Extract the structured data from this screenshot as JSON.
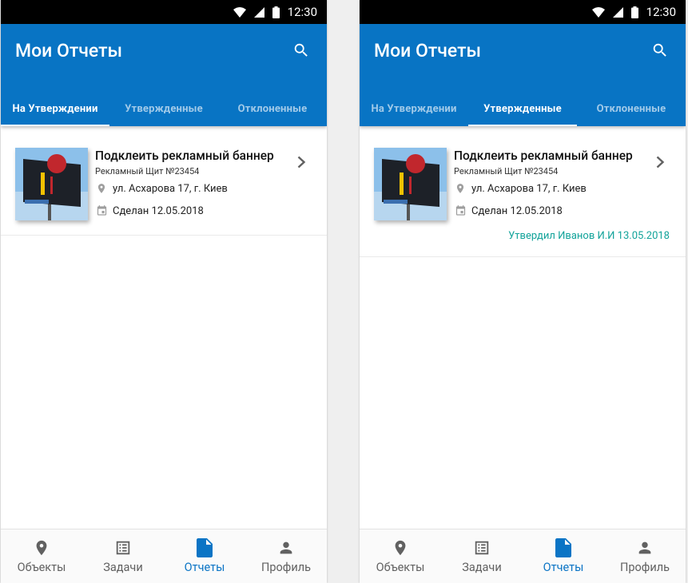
{
  "colors": {
    "primary": "#0874c4",
    "accent_active": "#0a74c5",
    "approved_text": "#12a39a",
    "status_bar": "#000000"
  },
  "screens": [
    {
      "status": {
        "time": "12:30"
      },
      "appbar": {
        "title": "Мои Отчеты"
      },
      "tabs": [
        {
          "label": "На Утверждении",
          "active": true
        },
        {
          "label": "Утвержденные",
          "active": false
        },
        {
          "label": "Отклоненные",
          "active": false
        }
      ],
      "report": {
        "title": "Подклеить рекламный баннер",
        "subtitle": "Рекламный Щит №23454",
        "address": "ул. Асхарова 17, г. Киев",
        "done": "Сделан 12.05.2018"
      },
      "nav": [
        {
          "label": "Объекты",
          "icon": "location-pin-icon"
        },
        {
          "label": "Задачи",
          "icon": "task-list-icon"
        },
        {
          "label": "Отчеты",
          "icon": "document-icon",
          "active": true
        },
        {
          "label": "Профиль",
          "icon": "person-icon"
        }
      ]
    },
    {
      "status": {
        "time": "12:30"
      },
      "appbar": {
        "title": "Мои Отчеты"
      },
      "tabs": [
        {
          "label": "На Утверждении",
          "active": false
        },
        {
          "label": "Утвержденные",
          "active": true
        },
        {
          "label": "Отклоненные",
          "active": false
        }
      ],
      "report": {
        "title": "Подклеить рекламный баннер",
        "subtitle": "Рекламный Щит №23454",
        "address": "ул. Асхарова 17, г. Киев",
        "done": "Сделан 12.05.2018",
        "approved": "Утвердил Иванов И.И 13.05.2018"
      },
      "nav": [
        {
          "label": "Объекты",
          "icon": "location-pin-icon"
        },
        {
          "label": "Задачи",
          "icon": "task-list-icon"
        },
        {
          "label": "Отчеты",
          "icon": "document-icon",
          "active": true
        },
        {
          "label": "Профиль",
          "icon": "person-icon"
        }
      ]
    }
  ]
}
